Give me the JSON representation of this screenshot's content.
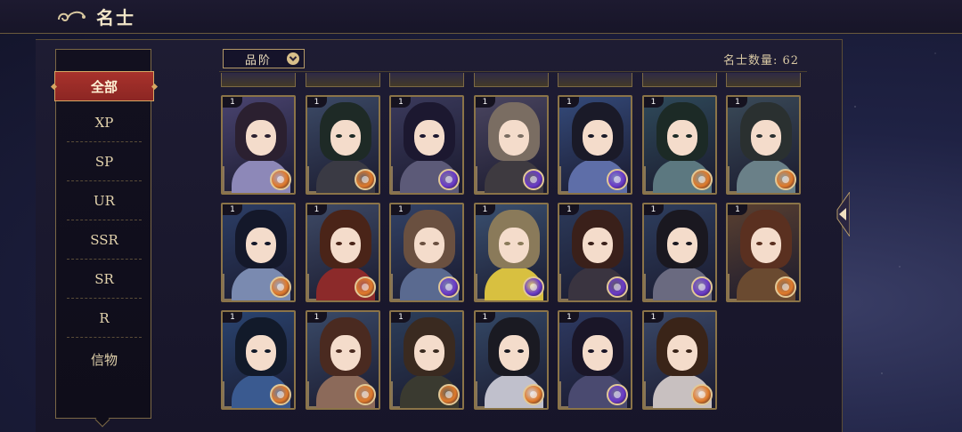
{
  "header": {
    "title": "名士"
  },
  "sidebar": {
    "items": [
      {
        "label": "全部",
        "active": true
      },
      {
        "label": "XP"
      },
      {
        "label": "SP"
      },
      {
        "label": "UR"
      },
      {
        "label": "SSR"
      },
      {
        "label": "SR"
      },
      {
        "label": "R"
      },
      {
        "label": "信物"
      }
    ]
  },
  "filter": {
    "label": "品阶"
  },
  "count_text": "名士数量: 62",
  "cards": [
    {
      "level": "1",
      "orb": "orange",
      "hair": "#2b2030",
      "cloth": "#8d88b8",
      "bg": "#4a4470"
    },
    {
      "level": "1",
      "orb": "orange",
      "hair": "#1e2a26",
      "cloth": "#3a3a44",
      "bg": "#3c4a66"
    },
    {
      "level": "1",
      "orb": "purple",
      "hair": "#1c1830",
      "cloth": "#5c5a78",
      "bg": "#3b3a5c"
    },
    {
      "level": "1",
      "orb": "purple",
      "hair": "#7a6d62",
      "cloth": "#3e3a40",
      "bg": "#4a4560"
    },
    {
      "level": "1",
      "orb": "purple",
      "hair": "#1a1a28",
      "cloth": "#5e6ea8",
      "bg": "#344a7a"
    },
    {
      "level": "1",
      "orb": "orange",
      "hair": "#1c2a26",
      "cloth": "#5c7880",
      "bg": "#2f4a5a"
    },
    {
      "level": "1",
      "orb": "orange",
      "hair": "#2a3030",
      "cloth": "#6a8088",
      "bg": "#3a4a58"
    },
    {
      "level": "1",
      "orb": "orange",
      "hair": "#14182a",
      "cloth": "#7a8ab0",
      "bg": "#2c3e66"
    },
    {
      "level": "1",
      "orb": "orange",
      "hair": "#4a2418",
      "cloth": "#8c2a2a",
      "bg": "#3e4a66"
    },
    {
      "level": "1",
      "orb": "purple",
      "hair": "#6a5040",
      "cloth": "#5a6a90",
      "bg": "#324266"
    },
    {
      "level": "1",
      "orb": "purple",
      "hair": "#8a7a5a",
      "cloth": "#d8c040",
      "bg": "#3a5070"
    },
    {
      "level": "1",
      "orb": "purple",
      "hair": "#3a201a",
      "cloth": "#3a3440",
      "bg": "#2c3a5a"
    },
    {
      "level": "1",
      "orb": "purple",
      "hair": "#1a1820",
      "cloth": "#6a6a80",
      "bg": "#2e3e5e"
    },
    {
      "level": "1",
      "orb": "orange",
      "hair": "#5a3020",
      "cloth": "#6a4a30",
      "bg": "#5a4030"
    },
    {
      "level": "1",
      "orb": "orange",
      "hair": "#121a2a",
      "cloth": "#3a5a90",
      "bg": "#2a4470"
    },
    {
      "level": "1",
      "orb": "orange",
      "hair": "#4a2a20",
      "cloth": "#8c6a5a",
      "bg": "#3a4a68"
    },
    {
      "level": "1",
      "orb": "orange",
      "hair": "#3a2a20",
      "cloth": "#3a3a30",
      "bg": "#2c3e5a"
    },
    {
      "level": "1",
      "orb": "orange",
      "hair": "#1a1a22",
      "cloth": "#c0c0cc",
      "bg": "#344866"
    },
    {
      "level": "1",
      "orb": "purple",
      "hair": "#1a1628",
      "cloth": "#4a4a70",
      "bg": "#2e3a62"
    },
    {
      "level": "1",
      "orb": "orange",
      "hair": "#3a2418",
      "cloth": "#c8c0c0",
      "bg": "#3a4868"
    }
  ],
  "colors": {
    "accent_red": "#a8322c",
    "gold": "#d6a763",
    "orb_orange": "#e07a2a",
    "orb_purple": "#6a3ac8"
  }
}
